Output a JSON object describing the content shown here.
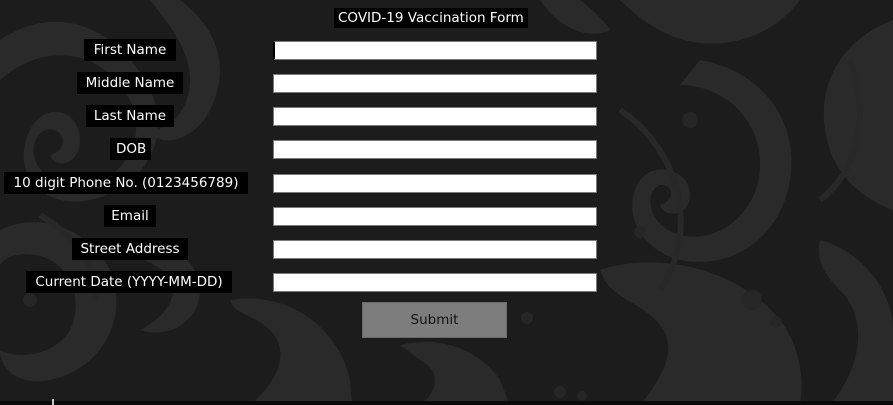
{
  "form": {
    "title": "COVID-19 Vaccination Form",
    "fields": [
      {
        "label": "First Name",
        "value": ""
      },
      {
        "label": "Middle Name",
        "value": ""
      },
      {
        "label": "Last Name",
        "value": ""
      },
      {
        "label": "DOB",
        "value": ""
      },
      {
        "label": "10 digit Phone No. (0123456789)",
        "value": ""
      },
      {
        "label": "Email",
        "value": ""
      },
      {
        "label": "Street Address",
        "value": ""
      },
      {
        "label": "Current Date (YYYY-MM-DD)",
        "value": ""
      }
    ],
    "submit_label": "Submit"
  },
  "colors": {
    "background": "#1b1b1b",
    "label_background": "#000000",
    "text": "#ffffff",
    "field_background": "#ffffff",
    "button_background": "#7d7d7d"
  }
}
